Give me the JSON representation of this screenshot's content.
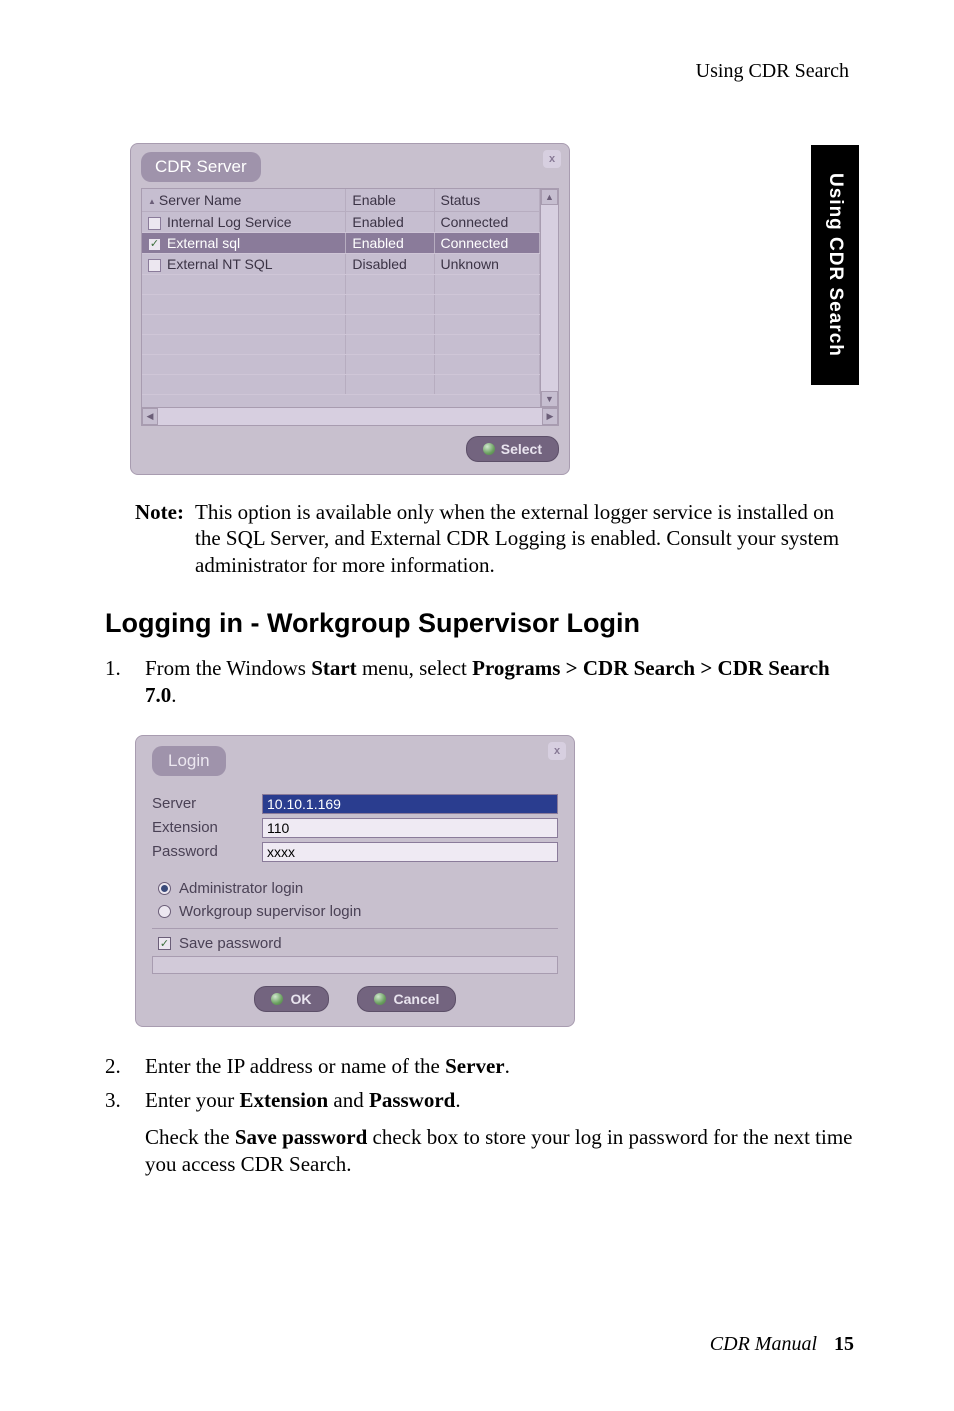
{
  "running_header": "Using CDR Search",
  "side_tab": "Using CDR Search",
  "cdr_dialog": {
    "title": "CDR Server",
    "columns": [
      "Server Name",
      "Enable",
      "Status"
    ],
    "rows": [
      {
        "checked": false,
        "selected": false,
        "name": "Internal Log Service",
        "enable": "Enabled",
        "status": "Connected"
      },
      {
        "checked": true,
        "selected": true,
        "name": "External sql",
        "enable": "Enabled",
        "status": "Connected"
      },
      {
        "checked": false,
        "selected": false,
        "name": "External NT SQL",
        "enable": "Disabled",
        "status": "Unknown"
      }
    ],
    "select_label": "Select"
  },
  "note": {
    "label": "Note:",
    "text": "This option is available only when the external logger service is installed on the SQL Server, and External CDR Logging is enabled. Consult your system administrator for more information."
  },
  "heading": "Logging in - Workgroup Supervisor Login",
  "step1": {
    "num": "1.",
    "pre": "From the Windows ",
    "b1": "Start",
    "mid1": " menu, select ",
    "b2": "Programs > CDR Search > CDR Search 7.0",
    "post": "."
  },
  "login_dialog": {
    "title": "Login",
    "server_label": "Server",
    "server_value": "10.10.1.169",
    "ext_label": "Extension",
    "ext_value": "110",
    "pwd_label": "Password",
    "pwd_value": "xxxx",
    "radio_admin": "Administrator login",
    "radio_wg": "Workgroup supervisor login",
    "save_pwd": "Save password",
    "ok": "OK",
    "cancel": "Cancel"
  },
  "step2": {
    "num": "2.",
    "pre": "Enter the IP address or name of the ",
    "b1": "Server",
    "post": "."
  },
  "step3": {
    "num": "3.",
    "pre": "Enter your ",
    "b1": "Extension",
    "mid": " and ",
    "b2": "Password",
    "post": ".",
    "sub_pre": "Check the ",
    "sub_b": "Save password",
    "sub_post": " check box to store your log in password for the next time you access CDR Search."
  },
  "footer": {
    "title": "CDR Manual",
    "page": "15"
  }
}
